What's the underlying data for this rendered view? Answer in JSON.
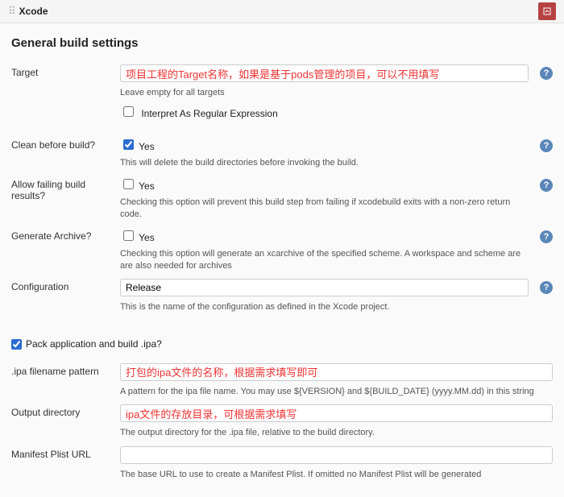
{
  "breadcrumb": {
    "title": "Xcode"
  },
  "topIcon": {
    "name": "red-box-icon"
  },
  "section": {
    "title": "General build settings"
  },
  "target": {
    "label": "Target",
    "value": "项目工程的Target名称，如果是基于pods管理的项目，可以不用填写",
    "hint": "Leave empty for all targets",
    "regexCheckbox": {
      "checked": false,
      "label": "Interpret As Regular Expression"
    }
  },
  "cleanBeforeBuild": {
    "label": "Clean before build?",
    "checkbox": {
      "checked": true,
      "label": "Yes"
    },
    "hint": "This will delete the build directories before invoking the build."
  },
  "allowFailing": {
    "label": "Allow failing build results?",
    "checkbox": {
      "checked": false,
      "label": "Yes"
    },
    "hint": "Checking this option will prevent this build step from failing if xcodebuild exits with a non-zero return code."
  },
  "generateArchive": {
    "label": "Generate Archive?",
    "checkbox": {
      "checked": false,
      "label": "Yes"
    },
    "hint": "Checking this option will generate an xcarchive of the specified scheme. A workspace and scheme are are also needed for archives"
  },
  "configuration": {
    "label": "Configuration",
    "value": "Release",
    "hint": "This is the name of the configuration as defined in the Xcode project."
  },
  "packIpa": {
    "checked": true,
    "label": "Pack application and build .ipa?"
  },
  "ipaPattern": {
    "label": ".ipa filename pattern",
    "value": "打包的ipa文件的名称，根据需求填写即可",
    "hint": "A pattern for the ipa file name. You may use ${VERSION} and ${BUILD_DATE} (yyyy.MM.dd) in this string"
  },
  "outputDir": {
    "label": "Output directory",
    "value": "ipa文件的存放目录，可根据需求填写",
    "hint": "The output directory for the .ipa file, relative to the build directory."
  },
  "manifestPlist": {
    "label": "Manifest Plist URL",
    "value": "",
    "hint": "The base URL to use to create a Manifest Plist. If omitted no Manifest Plist will be generated"
  }
}
